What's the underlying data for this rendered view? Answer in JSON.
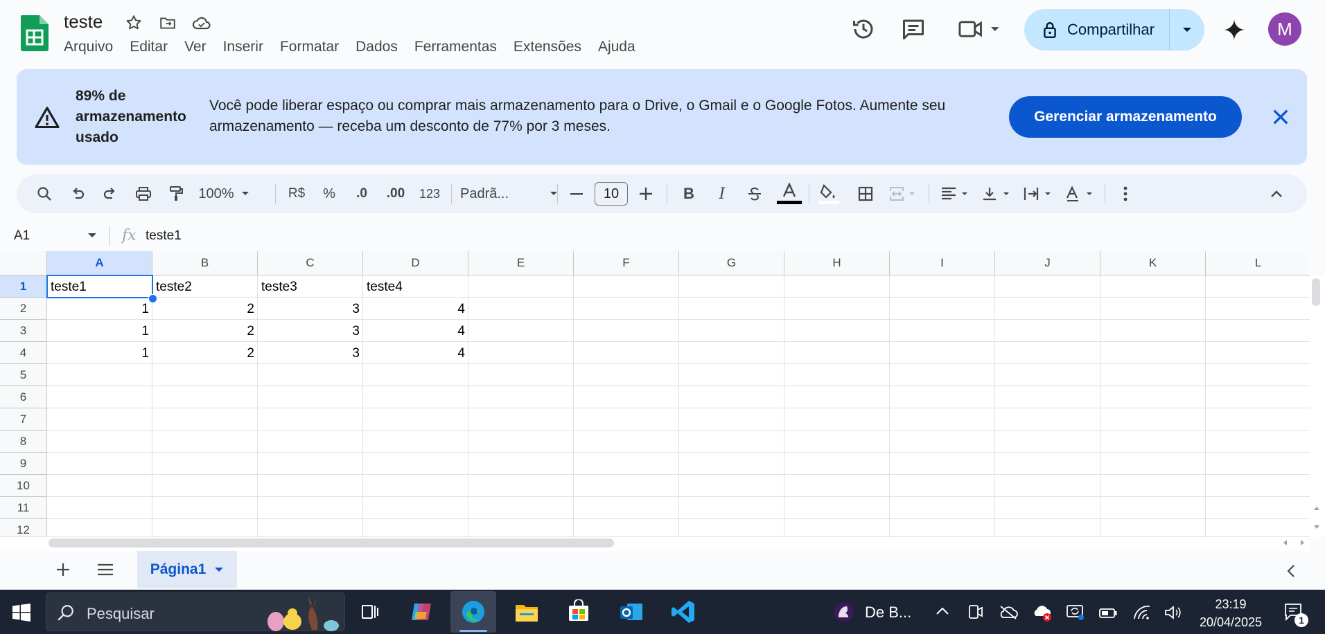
{
  "doc": {
    "title": "teste"
  },
  "menu": [
    "Arquivo",
    "Editar",
    "Ver",
    "Inserir",
    "Formatar",
    "Dados",
    "Ferramentas",
    "Extensões",
    "Ajuda"
  ],
  "share": {
    "label": "Compartilhar"
  },
  "user": {
    "initial": "M"
  },
  "banner": {
    "title": "89% de armazenamento usado",
    "text": "Você pode liberar espaço ou comprar mais armazenamento para o Drive, o Gmail e o Google Fotos. Aumente seu armazenamento — receba um desconto de 77% por 3 meses.",
    "button": "Gerenciar armazenamento"
  },
  "toolbar": {
    "zoom": "100%",
    "currency": "R$",
    "percent": "%",
    "dec_decrease": ".0",
    "dec_increase": ".00",
    "number_format": "123",
    "font": "Padrã...",
    "font_size": "10"
  },
  "formula": {
    "cell_ref": "A1",
    "fx": "fx",
    "value": "teste1"
  },
  "grid": {
    "columns": [
      "A",
      "B",
      "C",
      "D",
      "E",
      "F",
      "G",
      "H",
      "I",
      "J",
      "K",
      "L"
    ],
    "rows": [
      "1",
      "2",
      "3",
      "4",
      "5",
      "6",
      "7",
      "8",
      "9",
      "10",
      "11",
      "12"
    ],
    "cells": [
      [
        "teste1",
        "teste2",
        "teste3",
        "teste4"
      ],
      [
        "1",
        "2",
        "3",
        "4"
      ],
      [
        "1",
        "2",
        "3",
        "4"
      ],
      [
        "1",
        "2",
        "3",
        "4"
      ]
    ],
    "selected": "A1"
  },
  "sheets": {
    "active": "Página1"
  },
  "taskbar": {
    "search_placeholder": "Pesquisar",
    "news": "De B...",
    "time": "23:19",
    "date": "20/04/2025",
    "notification_count": "1"
  },
  "colors": {
    "accent": "#0b57d0",
    "banner": "#d3e3fd",
    "share": "#c2e7ff",
    "taskbar": "#1c2433",
    "sheets_green": "#0f9d58"
  }
}
